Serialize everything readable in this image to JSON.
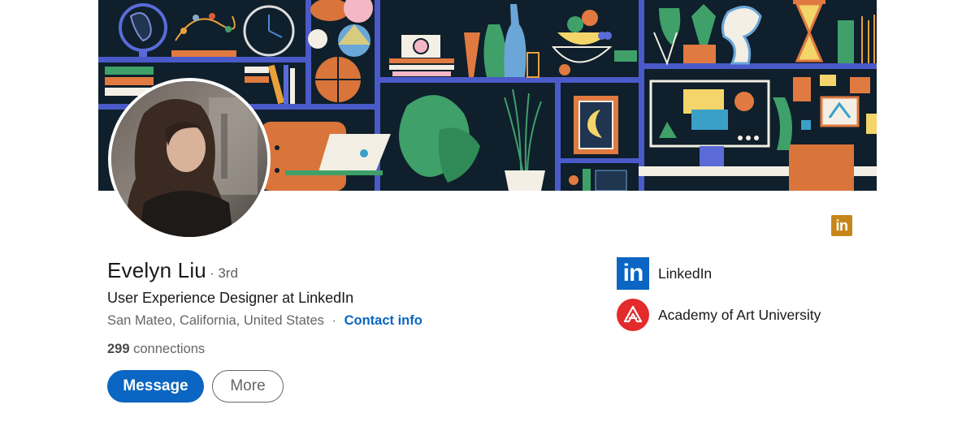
{
  "profile": {
    "name": "Evelyn Liu",
    "degree": "· 3rd",
    "headline": "User Experience Designer at LinkedIn",
    "location": "San Mateo, California, United States",
    "separator": "·",
    "contact_label": "Contact info",
    "connections_count": "299",
    "connections_label": "connections"
  },
  "actions": {
    "message_label": "Message",
    "more_label": "More"
  },
  "premium_badge": {
    "text": "in",
    "color": "#c7861a",
    "icon": "linkedin-premium-icon"
  },
  "experience": {
    "company": "LinkedIn",
    "company_logo_text": "in",
    "company_logo_color": "#0a66c2",
    "school": "Academy of Art University",
    "school_logo_color": "#e32b2b"
  },
  "colors": {
    "accent": "#0a66c2",
    "banner_bg": "#0f1f2b",
    "shelf": "#4a5ac8"
  }
}
